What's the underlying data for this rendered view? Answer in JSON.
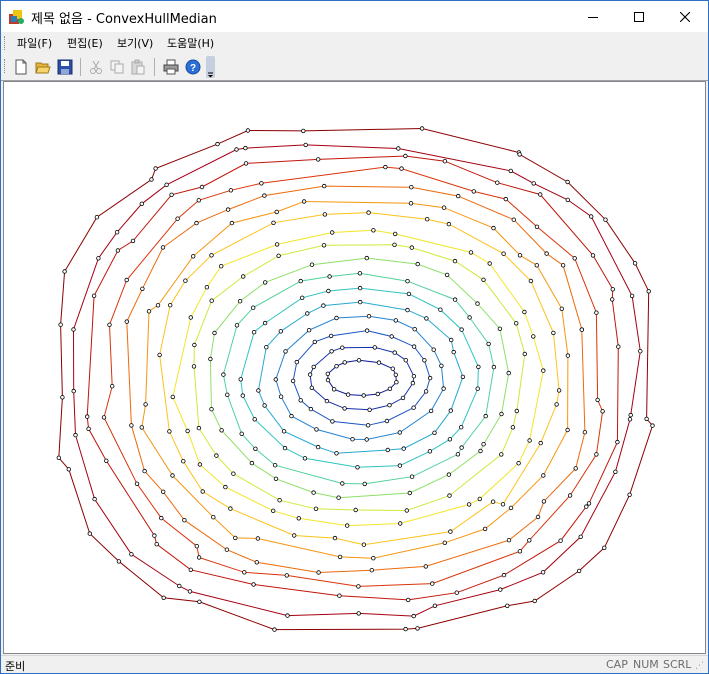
{
  "window": {
    "title": "제목 없음 - ConvexHullMedian"
  },
  "menu": [
    {
      "label": "파일(F)"
    },
    {
      "label": "편집(E)"
    },
    {
      "label": "보기(V)"
    },
    {
      "label": "도움말(H)"
    }
  ],
  "toolbar": {
    "buttons": [
      "new-document-icon",
      "open-folder-icon",
      "save-icon",
      "cut-icon",
      "copy-icon",
      "paste-icon",
      "print-icon",
      "help-icon"
    ],
    "disabled": [
      "cut-icon",
      "copy-icon",
      "paste-icon"
    ]
  },
  "status": {
    "text": "준비",
    "indicators": [
      "CAP",
      "NUM",
      "SCRL"
    ]
  },
  "layers": {
    "colors": [
      "#8b0000",
      "#a50010",
      "#c0150a",
      "#d9340a",
      "#ec6a0c",
      "#f5960f",
      "#fdc31b",
      "#f4e526",
      "#c9ec3a",
      "#8de067",
      "#52d19a",
      "#2ec4c0",
      "#26a8d0",
      "#2581cf",
      "#1a55c2",
      "#122fae",
      "#0a1699"
    ]
  }
}
